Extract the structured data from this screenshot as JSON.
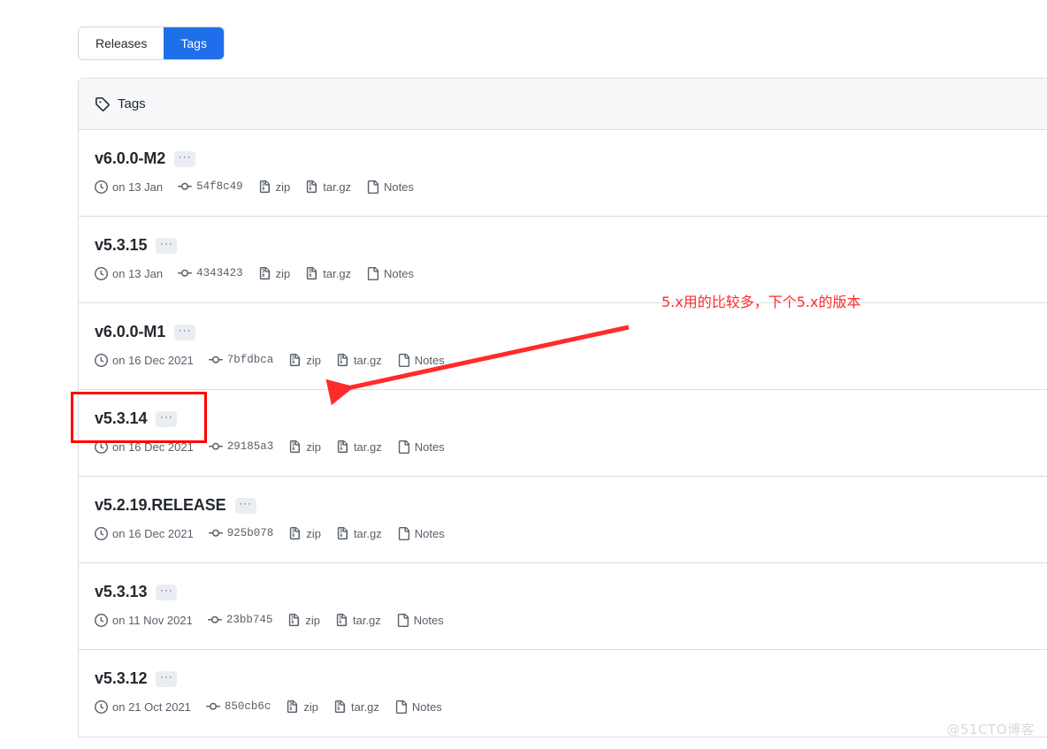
{
  "tabs": [
    {
      "label": "Releases",
      "active": false
    },
    {
      "label": "Tags",
      "active": true
    }
  ],
  "panel": {
    "header_title": "Tags",
    "header_icon": "tag-icon"
  },
  "tags": [
    {
      "name": "v6.0.0-M2",
      "menu": "···",
      "date": "on 13 Jan",
      "commit": "54f8c49",
      "zip": "zip",
      "targz": "tar.gz",
      "notes": "Notes"
    },
    {
      "name": "v5.3.15",
      "menu": "···",
      "date": "on 13 Jan",
      "commit": "4343423",
      "zip": "zip",
      "targz": "tar.gz",
      "notes": "Notes"
    },
    {
      "name": "v6.0.0-M1",
      "menu": "···",
      "date": "on 16 Dec 2021",
      "commit": "7bfdbca",
      "zip": "zip",
      "targz": "tar.gz",
      "notes": "Notes"
    },
    {
      "name": "v5.3.14",
      "menu": "···",
      "date": "on 16 Dec 2021",
      "commit": "29185a3",
      "zip": "zip",
      "targz": "tar.gz",
      "notes": "Notes"
    },
    {
      "name": "v5.2.19.RELEASE",
      "menu": "···",
      "date": "on 16 Dec 2021",
      "commit": "925b078",
      "zip": "zip",
      "targz": "tar.gz",
      "notes": "Notes"
    },
    {
      "name": "v5.3.13",
      "menu": "···",
      "date": "on 11 Nov 2021",
      "commit": "23bb745",
      "zip": "zip",
      "targz": "tar.gz",
      "notes": "Notes"
    },
    {
      "name": "v5.3.12",
      "menu": "···",
      "date": "on 21 Oct 2021",
      "commit": "850cb6c",
      "zip": "zip",
      "targz": "tar.gz",
      "notes": "Notes"
    }
  ],
  "annotations": {
    "note_text": "5.x用的比较多，下个5.x的版本",
    "note_color": "#ff2b2b",
    "highlight_color": "#ff0000",
    "highlight_target": "v5.3.14"
  },
  "watermark": {
    "text": "@51CTO博客"
  },
  "colors": {
    "accent_blue": "#1f6feb",
    "border": "#d8dee4",
    "header_bg": "#f6f8fa",
    "text_primary": "#24292f",
    "text_muted": "#57606a"
  }
}
